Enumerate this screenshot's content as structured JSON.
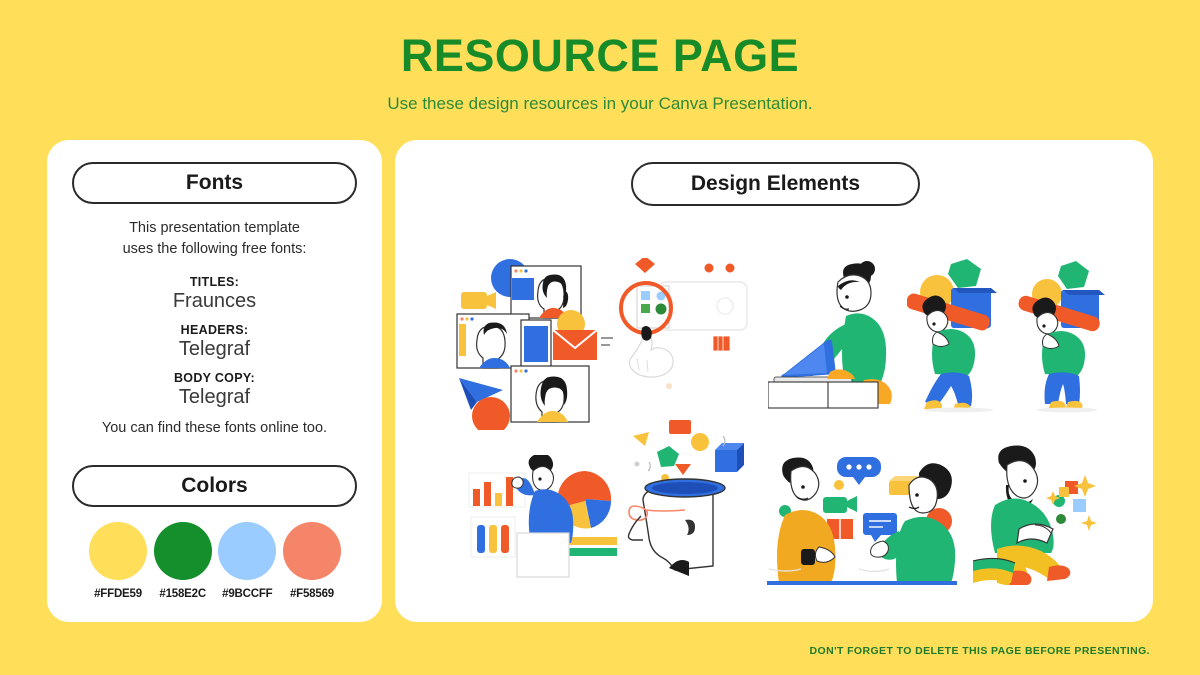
{
  "slide": {
    "background_color": "#FFDE59",
    "title": "RESOURCE PAGE",
    "title_color": "#188B29",
    "subtitle": "Use these design resources in your Canva Presentation.",
    "footer_note": "DON'T FORGET TO DELETE THIS PAGE BEFORE PRESENTING."
  },
  "fonts_panel": {
    "heading": "Fonts",
    "intro": "This presentation template\nuses the following free fonts:",
    "intro_line_1": "This presentation template",
    "intro_line_2": "uses the following free fonts:",
    "groups": [
      {
        "label": "TITLES:",
        "value": "Fraunces"
      },
      {
        "label": "HEADERS:",
        "value": "Telegraf"
      },
      {
        "label": "BODY COPY:",
        "value": "Telegraf"
      }
    ],
    "outro": "You can find these fonts online too."
  },
  "colors_panel": {
    "heading": "Colors",
    "swatches": [
      {
        "hex": "#FFDE59",
        "name": "yellow"
      },
      {
        "hex": "#158E2C",
        "name": "green"
      },
      {
        "hex": "#9BCCFF",
        "name": "light-blue"
      },
      {
        "hex": "#F58569",
        "name": "coral"
      }
    ]
  },
  "elements_panel": {
    "heading": "Design Elements",
    "illustrations": [
      {
        "id": "video-call-windows",
        "caption": "video call windows with paper plane and envelope"
      },
      {
        "id": "hand-pointing-screen",
        "caption": "hand pointing at highlighted screen"
      },
      {
        "id": "person-at-laptop-desk",
        "caption": "person working at desk with laptop"
      },
      {
        "id": "person-carrying-shapes-walking",
        "caption": "person carrying geometric shapes, walking"
      },
      {
        "id": "person-carrying-shapes-standing",
        "caption": "person carrying geometric shapes, standing"
      },
      {
        "id": "person-presenting-charts",
        "caption": "person presenting bar and pie charts"
      },
      {
        "id": "open-head-ideas",
        "caption": "open head with floating shapes"
      },
      {
        "id": "two-people-chatting",
        "caption": "two people chatting with message bubbles"
      },
      {
        "id": "person-reading-book",
        "caption": "bearded person reading a book"
      }
    ]
  }
}
